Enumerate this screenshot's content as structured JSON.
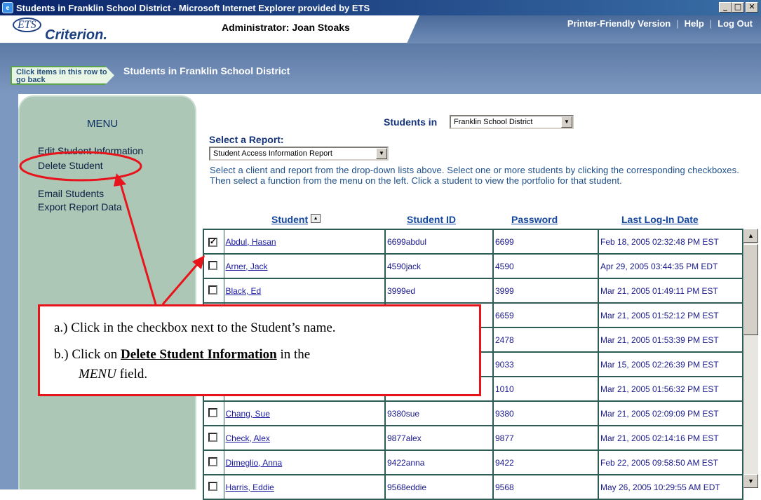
{
  "window": {
    "title": "Students in Franklin School District - Microsoft Internet Explorer provided by ETS",
    "buttons": [
      "_",
      "□",
      "✕"
    ]
  },
  "header": {
    "logo_ets": "ETS",
    "logo_product": "Criterion.",
    "admin_label": "Administrator: Joan Stoaks",
    "links": [
      "Printer-Friendly Version",
      "Help",
      "Log Out"
    ],
    "separator": "|"
  },
  "nav": {
    "back_button": "Click items in this row to go back",
    "breadcrumb": "Students in Franklin School District"
  },
  "menu": {
    "title": "MENU",
    "items": [
      "Edit Student Information",
      "Delete Student",
      "Email Students",
      "Export Report Data"
    ]
  },
  "main": {
    "students_in_label": "Students in",
    "district_select": "Franklin School District",
    "select_report_label": "Select a Report:",
    "report_select": "Student Access Information Report",
    "instructions": "Select a client and report from the drop-down lists above. Select one or more students by clicking the corresponding checkboxes. Then select a function from the menu on the left. Click a student to view the portfolio for that student.",
    "columns": [
      "Student",
      "Student ID",
      "Password",
      "Last Log-In Date"
    ],
    "rows": [
      {
        "checked": true,
        "name": "Abdul, Hasan",
        "id": "6699abdul",
        "password": "6699",
        "date": "Feb 18, 2005 02:32:48 PM EST"
      },
      {
        "checked": false,
        "name": "Arner, Jack",
        "id": "4590jack",
        "password": "4590",
        "date": "Apr 29, 2005 03:44:35 PM EDT"
      },
      {
        "checked": false,
        "name": "Black, Ed",
        "id": "3999ed",
        "password": "3999",
        "date": "Mar 21, 2005 01:49:11 PM EST"
      },
      {
        "checked": false,
        "name": "",
        "id": "",
        "password": "6659",
        "date": "Mar 21, 2005 01:52:12 PM EST"
      },
      {
        "checked": false,
        "name": "",
        "id": "",
        "password": "2478",
        "date": "Mar 21, 2005 01:53:39 PM EST"
      },
      {
        "checked": false,
        "name": "",
        "id": "",
        "password": "9033",
        "date": "Mar 15, 2005 02:26:39 PM EST"
      },
      {
        "checked": false,
        "name": "",
        "id": "",
        "password": "1010",
        "date": "Mar 21, 2005 01:56:32 PM EST"
      },
      {
        "checked": false,
        "name": "Chang, Sue",
        "id": "9380sue",
        "password": "9380",
        "date": "Mar 21, 2005 02:09:09 PM EST"
      },
      {
        "checked": false,
        "name": "Check, Alex",
        "id": "9877alex",
        "password": "9877",
        "date": "Mar 21, 2005 02:14:16 PM EST"
      },
      {
        "checked": false,
        "name": "Dimeglio, Anna",
        "id": "9422anna",
        "password": "9422",
        "date": "Feb 22, 2005 09:58:50 AM EST"
      },
      {
        "checked": false,
        "name": "Harris, Eddie",
        "id": "9568eddie",
        "password": "9568",
        "date": "May 26, 2005 10:29:55 AM EDT"
      }
    ]
  },
  "callout": {
    "line_a": "a.)  Click in the checkbox next to the Student’s name.",
    "line_b_prefix": "b.)  Click on ",
    "line_b_bold": "Delete Student Information",
    "line_b_suffix": " in the",
    "line_c_italic": "MENU",
    "line_c_suffix": " field."
  },
  "colors": {
    "annotation": "#e8141c",
    "menu_panel": "#acc7b6",
    "nav_blue": "#5c7aa6"
  }
}
